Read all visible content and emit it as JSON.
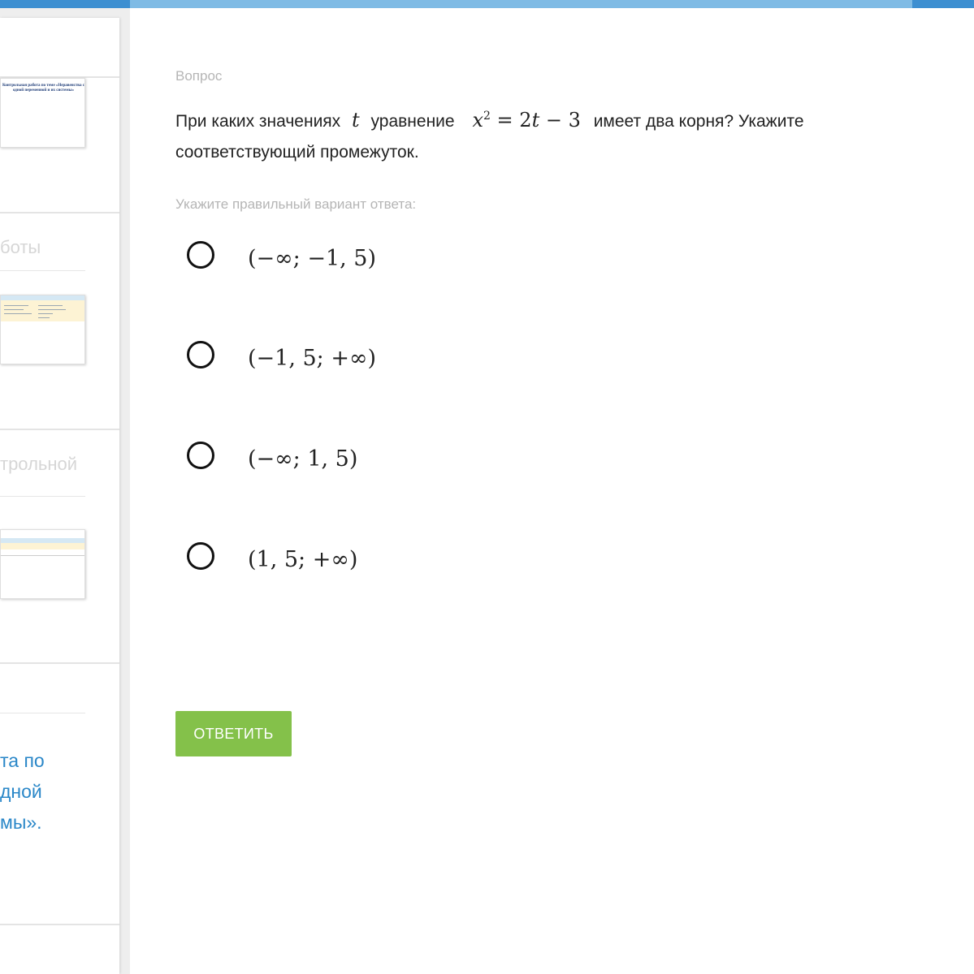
{
  "sidebar": {
    "thumb1_title": "Контрольная работа по теме «Неравенства с одной переменной и их системы»",
    "faded_text_1": "боты",
    "faded_text_2": "трольной",
    "link_text": "та по\nдной\nмы»."
  },
  "main": {
    "question_label": "Вопрос",
    "question_part1": "При каких значениях",
    "question_var": "t",
    "question_part2": "уравнение",
    "question_part3": "имеет два корня? Укажите соответствующий промежуток.",
    "equation": {
      "lhs_var": "x",
      "exponent": "2",
      "rhs": "= 2",
      "rhs_var": "t",
      "rhs_tail": " − 3"
    },
    "answer_hint": "Укажите правильный вариант ответа:",
    "options": [
      {
        "label": "(−∞; −1, 5)",
        "selected": false
      },
      {
        "label": "(−1, 5; +∞)",
        "selected": false
      },
      {
        "label": "(−∞; 1, 5)",
        "selected": false
      },
      {
        "label": "(1, 5; +∞)",
        "selected": false
      }
    ],
    "submit_label": "ОТВЕТИТЬ"
  },
  "colors": {
    "accent": "#3d8fd1",
    "progress": "#7fbbe5",
    "button": "#84c14a",
    "link": "#2a87c8"
  }
}
